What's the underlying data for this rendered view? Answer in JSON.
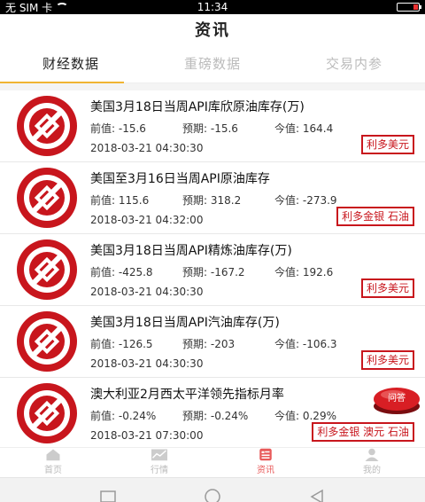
{
  "status": {
    "carrier": "无 SIM 卡",
    "time": "11:34"
  },
  "header": {
    "title": "资讯"
  },
  "tabs": [
    {
      "label": "财经数据",
      "active": true
    },
    {
      "label": "重磅数据",
      "active": false
    },
    {
      "label": "交易内参",
      "active": false
    }
  ],
  "items": [
    {
      "title": "美国3月18日当周API库欣原油库存(万)",
      "prev": "前值: -15.6",
      "forecast": "预期: -15.6",
      "actual": "今值: 164.4",
      "date": "2018-03-21 04:30:30",
      "tag": "利多美元"
    },
    {
      "title": "美国至3月16日当周API原油库存",
      "prev": "前值: 115.6",
      "forecast": "预期: 318.2",
      "actual": "今值: -273.9",
      "date": "2018-03-21 04:32:00",
      "tag": "利多金银 石油"
    },
    {
      "title": "美国3月18日当周API精炼油库存(万)",
      "prev": "前值: -425.8",
      "forecast": "预期: -167.2",
      "actual": "今值: 192.6",
      "date": "2018-03-21 04:30:30",
      "tag": "利多美元"
    },
    {
      "title": "美国3月18日当周API汽油库存(万)",
      "prev": "前值: -126.5",
      "forecast": "预期: -203",
      "actual": "今值: -106.3",
      "date": "2018-03-21 04:30:30",
      "tag": "利多美元"
    },
    {
      "title": "澳大利亚2月西太平洋领先指标月率",
      "prev": "前值: -0.24%",
      "forecast": "预期: -0.24%",
      "actual": "今值: 0.29%",
      "date": "2018-03-21 07:30:00",
      "tag": "利多金银 澳元 石油"
    }
  ],
  "qa_button": {
    "label": "问答"
  },
  "nav": [
    {
      "label": "首页",
      "active": false
    },
    {
      "label": "行情",
      "active": false
    },
    {
      "label": "资讯",
      "active": true
    },
    {
      "label": "我的",
      "active": false
    }
  ],
  "colors": {
    "accent_red": "#c8161d",
    "tab_underline": "#f0b432",
    "nav_active": "#e85a5a"
  }
}
